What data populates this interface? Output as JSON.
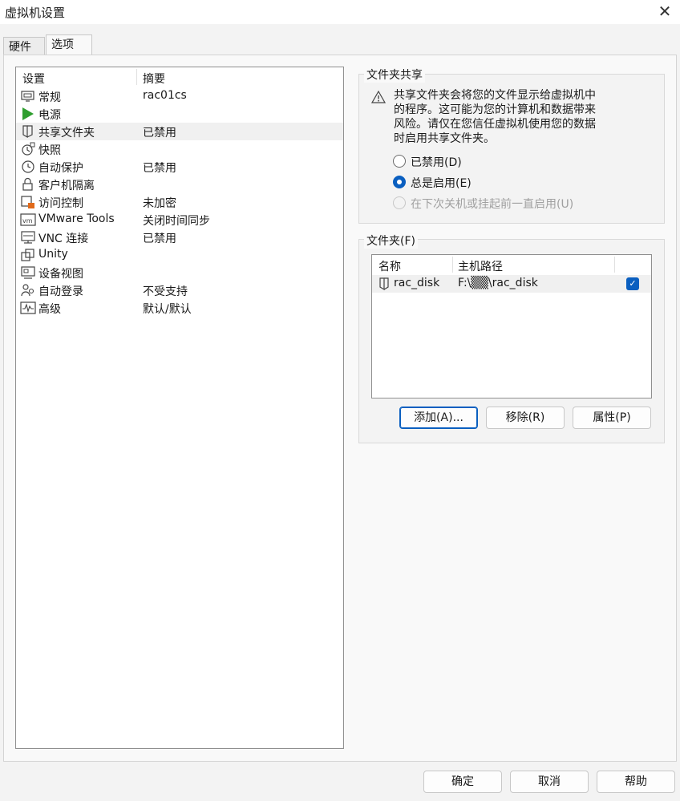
{
  "window": {
    "title": "虚拟机设置"
  },
  "tabs": [
    {
      "label": "硬件"
    },
    {
      "label": "选项"
    }
  ],
  "settings_list": {
    "col_setting": "设置",
    "col_summary": "摘要",
    "items": [
      {
        "name": "常规",
        "summary": "rac01cs",
        "icon": "monitor-icon"
      },
      {
        "name": "电源",
        "summary": "",
        "icon": "play-icon"
      },
      {
        "name": "共享文件夹",
        "summary": "已禁用",
        "icon": "folder-icon"
      },
      {
        "name": "快照",
        "summary": "",
        "icon": "snapshot-icon"
      },
      {
        "name": "自动保护",
        "summary": "已禁用",
        "icon": "clock-icon"
      },
      {
        "name": "客户机隔离",
        "summary": "",
        "icon": "lock-icon"
      },
      {
        "name": "访问控制",
        "summary": "未加密",
        "icon": "access-control-icon"
      },
      {
        "name": "VMware Tools",
        "summary": "关闭时间同步",
        "icon": "vm-icon"
      },
      {
        "name": "VNC 连接",
        "summary": "已禁用",
        "icon": "vnc-icon"
      },
      {
        "name": "Unity",
        "summary": "",
        "icon": "unity-icon"
      },
      {
        "name": "设备视图",
        "summary": "",
        "icon": "device-view-icon"
      },
      {
        "name": "自动登录",
        "summary": "不受支持",
        "icon": "users-icon"
      },
      {
        "name": "高级",
        "summary": "默认/默认",
        "icon": "advanced-icon"
      }
    ],
    "selected": "共享文件夹"
  },
  "sharing": {
    "group_label": "文件夹共享",
    "warning_lines": [
      "共享文件夹会将您的文件显示给虚拟机中",
      "的程序。这可能为您的计算机和数据带来",
      "风险。请仅在您信任虚拟机使用您的数据",
      "时启用共享文件夹。"
    ],
    "options": [
      {
        "label": "已禁用(D)",
        "state": "off"
      },
      {
        "label": "总是启用(E)",
        "state": "on"
      },
      {
        "label": "在下次关机或挂起前一直启用(U)",
        "state": "disabled"
      }
    ]
  },
  "folders": {
    "group_label": "文件夹(F)",
    "col_name": "名称",
    "col_path": "主机路径",
    "rows": [
      {
        "name": "rac_disk",
        "path": "F:\\▒▒\\rac_disk",
        "enabled": true
      }
    ],
    "buttons": {
      "add": "添加(A)...",
      "remove": "移除(R)",
      "properties": "属性(P)"
    }
  },
  "footer": {
    "ok": "确定",
    "cancel": "取消",
    "help": "帮助"
  },
  "colors": {
    "accent": "#0a5fc0",
    "power_green": "#2e9e2e",
    "lock_orange": "#e06a1a"
  }
}
